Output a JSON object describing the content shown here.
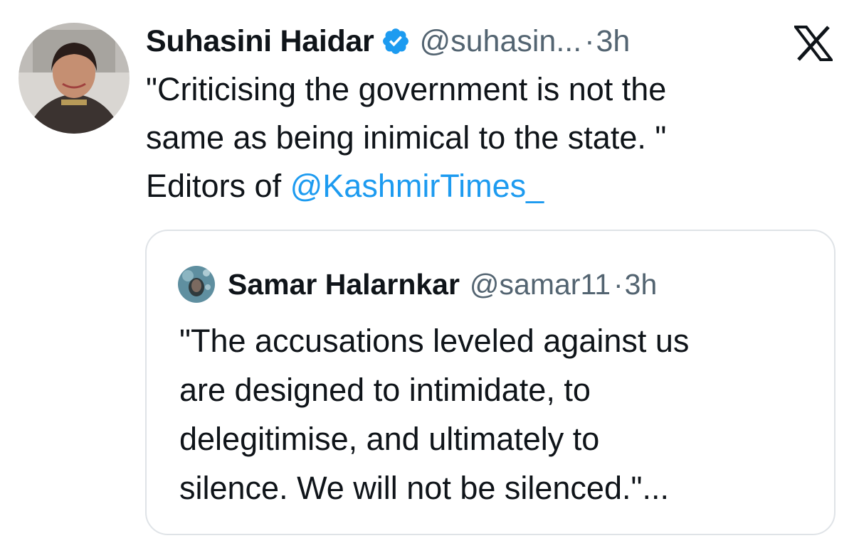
{
  "tweet": {
    "author": {
      "display_name": "Suhasini Haidar",
      "handle": "@suhasin...",
      "separator": "·",
      "time": "3h",
      "verified_icon": "verified-badge-icon",
      "verified_color": "#1d9bf0"
    },
    "platform_icon": "x-logo-icon",
    "body": {
      "line1": "\"Criticising the government is not the",
      "line2": "same as being inimical to the state. \"",
      "line3_prefix": "Editors of ",
      "mention": "@KashmirTimes_"
    },
    "quote": {
      "author": {
        "display_name": "Samar Halarnkar",
        "handle": "@samar11",
        "separator": "·",
        "time": "3h"
      },
      "lines": [
        "\"The accusations leveled against us",
        "are designed to intimidate, to",
        "delegitimise, and ultimately to",
        "silence. We will not be silenced.\"..."
      ]
    }
  },
  "colors": {
    "text": "#0f1419",
    "secondary": "#536471",
    "link": "#1d9bf0",
    "border": "#dfe3e7"
  }
}
